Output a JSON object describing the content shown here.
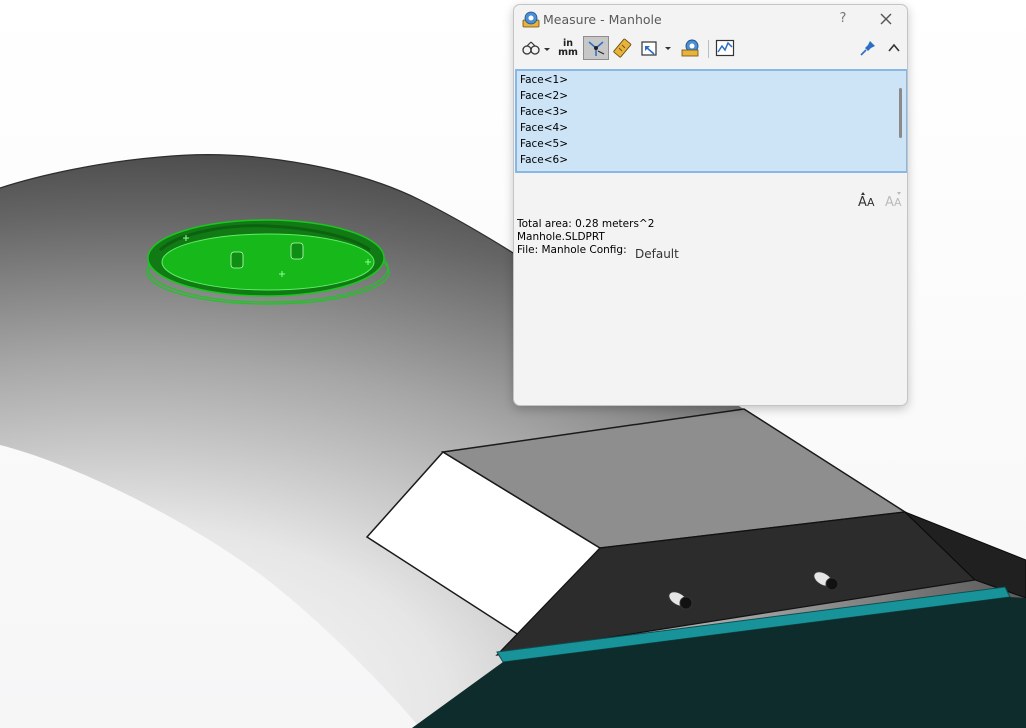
{
  "dialog": {
    "title": "Measure - Manhole",
    "help_label": "?",
    "toolbar": {
      "units_top": "in",
      "units_bottom": "mm"
    },
    "selection_list": [
      "Face<1>",
      "Face<2>",
      "Face<3>",
      "Face<4>",
      "Face<5>",
      "Face<6>"
    ],
    "results": {
      "total_area": "Total area: 0.28 meters^2",
      "file_name": "Manhole.SLDPRT",
      "config_label": "File: Manhole Config:",
      "config_value": "Default"
    }
  },
  "colors": {
    "selection_highlight": "#19c81f",
    "list_bg": "#cde4f7",
    "list_border": "#86b7e5",
    "dark_surface": "#0e2c2b",
    "teal_strip": "#19939a"
  },
  "icons": {
    "title": "measure-tool-icon",
    "close": "close-icon",
    "arc_circle": "arc-circle-measure-icon",
    "units": "units-precision-icon",
    "xyz": "xyz-measure-icon",
    "point_to_point": "point-to-point-icon",
    "projection": "projection-icon",
    "sensor": "create-sensor-icon",
    "history": "measurement-history-icon",
    "pin": "pin-icon",
    "collapse": "collapse-icon",
    "font_increase": "increase-font-icon",
    "font_decrease": "decrease-font-icon"
  }
}
